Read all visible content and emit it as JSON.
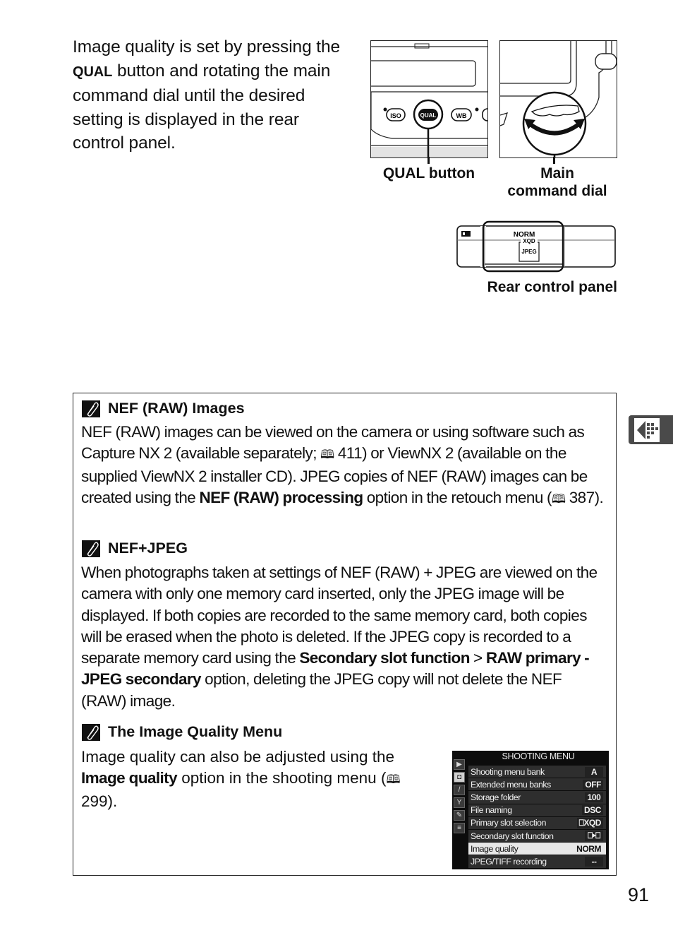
{
  "intro": {
    "pre": "Image quality is set by pressing the ",
    "bold": "QUAL",
    "post": " button and rotating the main command dial until the desired setting is displayed in the rear control panel."
  },
  "figures": {
    "qual_button_label": "QUAL button",
    "main_dial_label_1": "Main",
    "main_dial_label_2": "command dial",
    "rear_panel_label": "Rear control panel",
    "camera_buttons": [
      "ISO",
      "QUAL",
      "WB"
    ],
    "panel_display": {
      "quality": "NORM",
      "card": "XQD",
      "format": "JPEG"
    }
  },
  "notes": [
    {
      "title": "NEF (RAW) Images",
      "icon": "paperclip-icon",
      "p1": "NEF (RAW) images can be viewed on the camera or using software such as Capture NX 2 (available separately; ",
      "ref1": "411",
      "p2": ") or ViewNX 2 (available on the supplied ViewNX 2 installer CD).  JPEG copies of NEF (RAW) images can be created using the ",
      "bold1": "NEF (RAW) processing",
      "p3": " option in the retouch menu (",
      "ref2": "387",
      "p4": ")."
    },
    {
      "title": "NEF+JPEG",
      "icon": "paperclip-icon",
      "p1": "When photographs taken at settings of NEF (RAW) + JPEG are viewed on the camera with only one memory card inserted, only the JPEG image will be displayed.  If both copies are recorded to the same memory card, both copies will be erased when the photo is deleted.  If the JPEG copy is recorded to a separate memory card using the ",
      "bold1": "Secondary slot function",
      "sep": " > ",
      "bold2": "RAW primary - JPEG secondary",
      "p2": " option, deleting the JPEG copy will not delete the NEF (RAW) image."
    },
    {
      "title": "The Image Quality Menu",
      "icon": "paperclip-icon",
      "p1": "Image quality can also be adjusted using the ",
      "bold1": "Image quality",
      "p2": " option in the shooting menu (",
      "ref1": "299",
      "p3": ")."
    }
  ],
  "shooting_menu": {
    "title": "SHOOTING MENU",
    "rows": [
      {
        "label": "Shooting menu bank",
        "value": "A"
      },
      {
        "label": "Extended menu banks",
        "value": "OFF"
      },
      {
        "label": "Storage folder",
        "value": "100"
      },
      {
        "label": "File naming",
        "value": "DSC"
      },
      {
        "label": "Primary slot selection",
        "value": "⎕XQD"
      },
      {
        "label": "Secondary slot function",
        "value": "⎕▸⎕"
      },
      {
        "label": "Image quality",
        "value": "NORM",
        "selected": true
      },
      {
        "label": "JPEG/TIFF recording",
        "value": "--"
      }
    ],
    "side_icons": [
      "▶",
      "◘",
      "/",
      "Y",
      "✎",
      "≡"
    ]
  },
  "book_icon": "🕮",
  "page_number": "91"
}
